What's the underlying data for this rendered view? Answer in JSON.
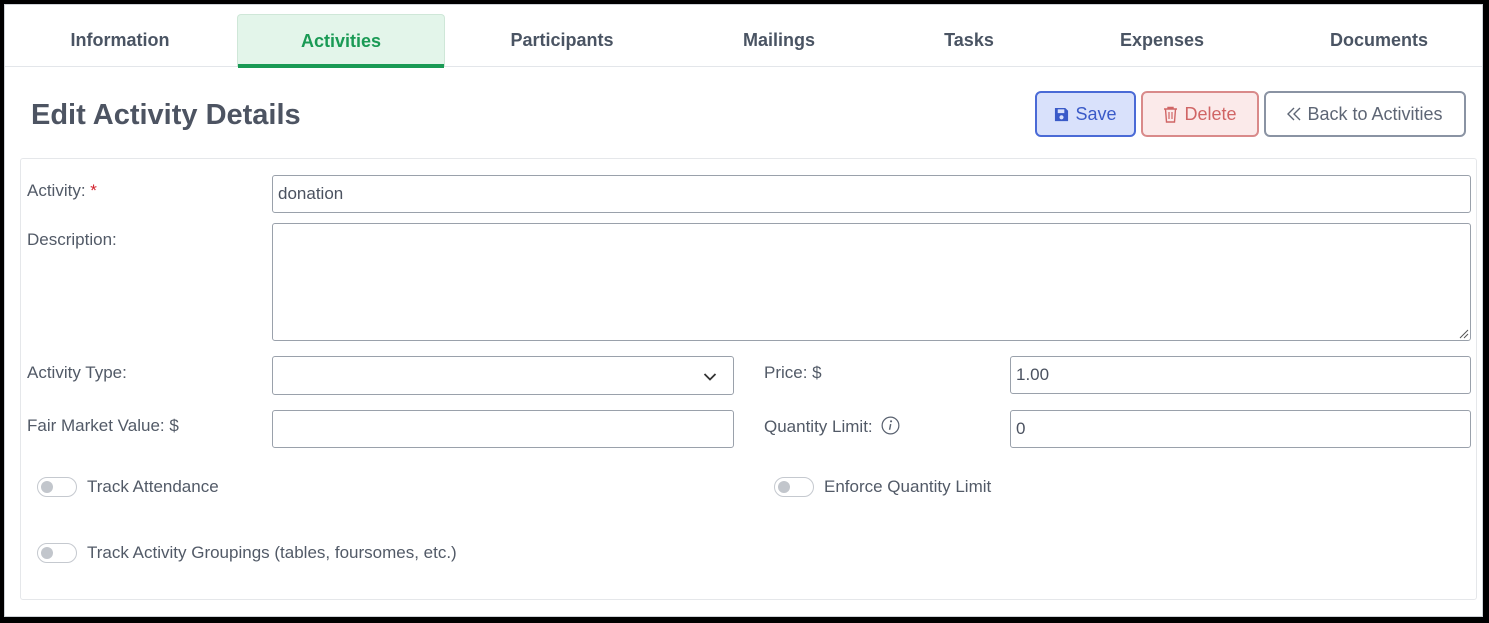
{
  "tabs": [
    {
      "label": "Information"
    },
    {
      "label": "Activities",
      "active": true
    },
    {
      "label": "Participants"
    },
    {
      "label": "Mailings"
    },
    {
      "label": "Tasks"
    },
    {
      "label": "Expenses"
    },
    {
      "label": "Documents"
    }
  ],
  "header": {
    "title": "Edit Activity Details",
    "save_label": "Save",
    "delete_label": "Delete",
    "back_label": "Back to Activities"
  },
  "form": {
    "activity_label": "Activity:",
    "required_mark": "*",
    "activity_value": "donation",
    "description_label": "Description:",
    "description_value": "",
    "activity_type_label": "Activity Type:",
    "activity_type_value": "",
    "price_label": "Price: $",
    "price_value": "1.00",
    "fmv_label": "Fair Market Value: $",
    "fmv_value": "",
    "quantity_limit_label": "Quantity Limit:",
    "quantity_limit_value": "0",
    "track_attendance_label": "Track Attendance",
    "enforce_quantity_label": "Enforce Quantity Limit",
    "track_groupings_label": "Track Activity Groupings (tables, foursomes, etc.)"
  },
  "colors": {
    "active_tab": "#1a9a55",
    "save": "#3a5ac8",
    "delete": "#d06565",
    "required": "#d11e2a"
  },
  "icons": {
    "save": "floppy-disk-icon",
    "delete": "trash-icon",
    "back": "double-chevron-left-icon",
    "select": "chevron-down-icon",
    "info": "info-circle-icon"
  }
}
